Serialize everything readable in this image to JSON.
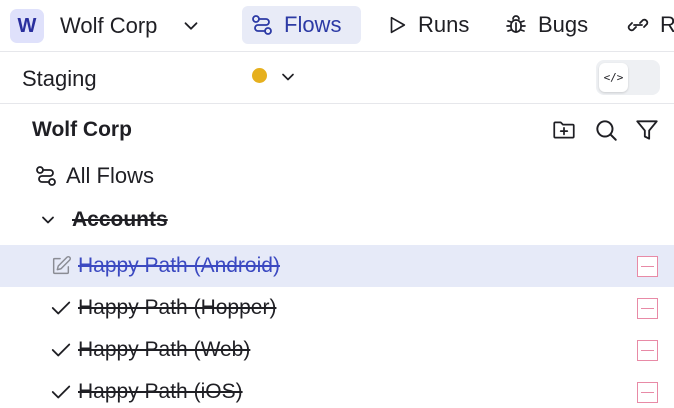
{
  "workspace": {
    "initial": "W",
    "name": "Wolf Corp"
  },
  "nav": {
    "tabs": [
      {
        "label": "Flows",
        "icon": "flows-icon",
        "active": true
      },
      {
        "label": "Runs",
        "icon": "play-icon",
        "active": false
      },
      {
        "label": "Bugs",
        "icon": "bug-icon",
        "active": false
      },
      {
        "label": "R",
        "icon": "link-icon",
        "active": false
      }
    ]
  },
  "environment": {
    "name": "Staging",
    "status_color": "#e6b01e",
    "code_toggle_icon": "</>"
  },
  "tree": {
    "org_name": "Wolf Corp",
    "actions": [
      "new-folder-icon",
      "search-icon",
      "filter-icon"
    ],
    "all_flows_label": "All Flows",
    "folder": {
      "name": "Accounts",
      "expanded": true
    },
    "flows": [
      {
        "name": "Happy Path (Android)",
        "status": "edit",
        "selected": true
      },
      {
        "name": "Happy Path (Hopper)",
        "status": "check",
        "selected": false
      },
      {
        "name": "Happy Path (Web)",
        "status": "check",
        "selected": false
      },
      {
        "name": "Happy Path (iOS)",
        "status": "check",
        "selected": false
      }
    ]
  },
  "colors": {
    "accent": "#2c3aa5",
    "active_tab_bg": "#e8ebf7",
    "selected_row_bg": "#e6eaf8",
    "remove_border": "#e88aa6"
  }
}
